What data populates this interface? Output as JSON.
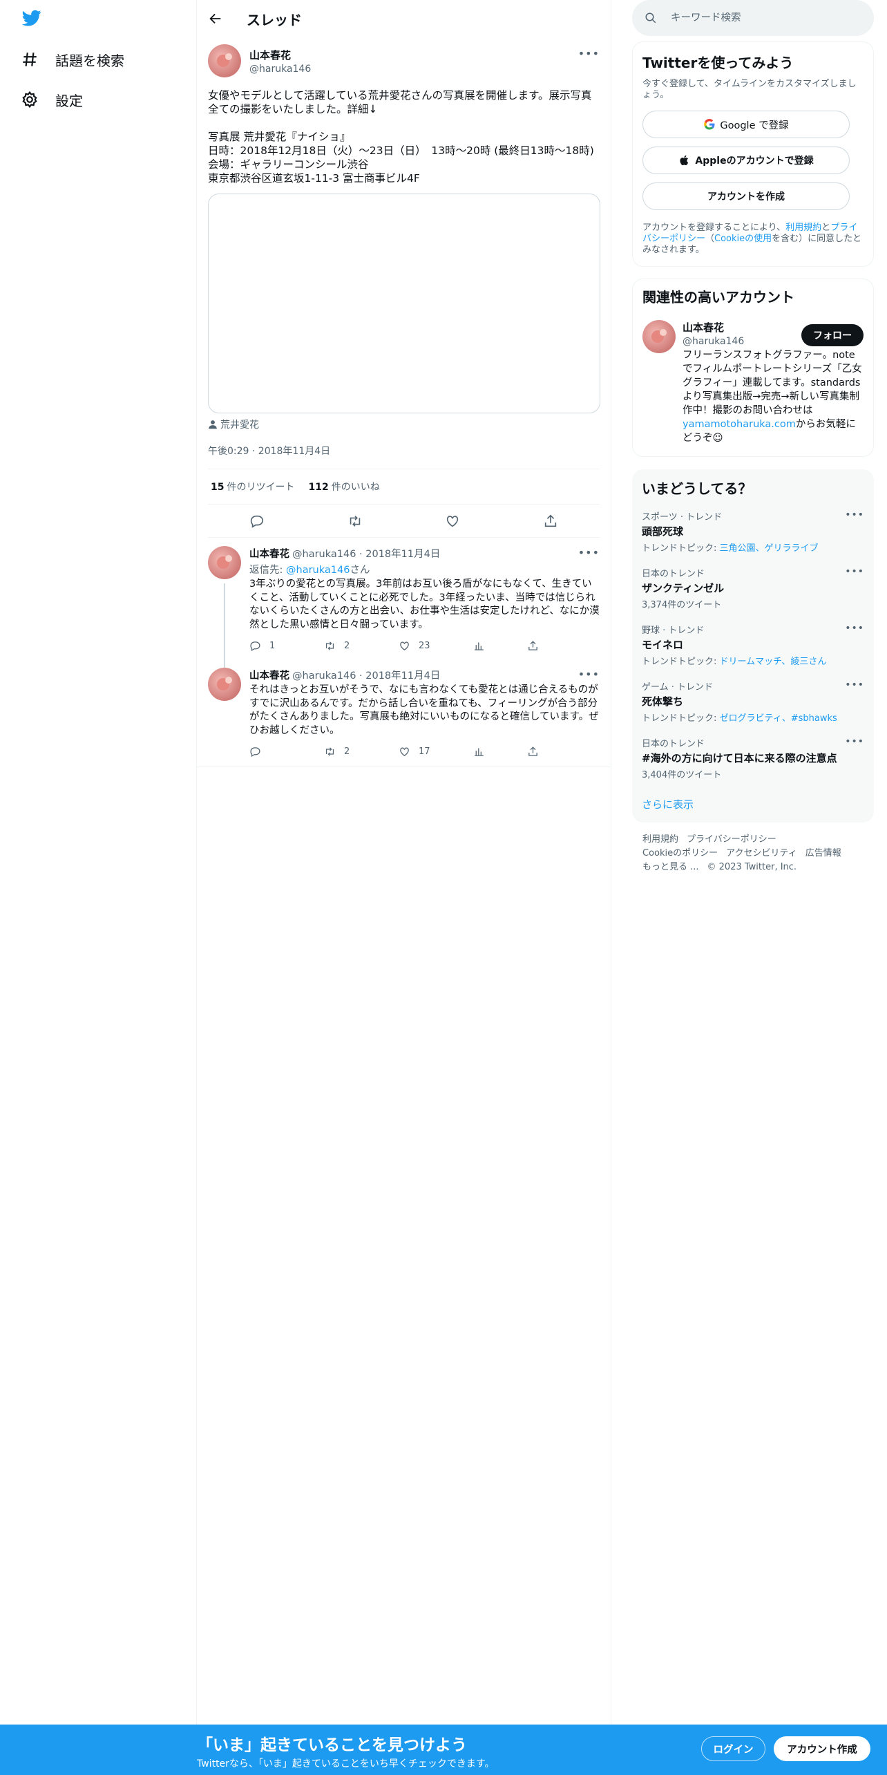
{
  "nav": {
    "explore_label": "話題を検索",
    "settings_label": "設定"
  },
  "header": {
    "title": "スレッド"
  },
  "tweet": {
    "name": "山本春花",
    "handle": "@haruka146",
    "text": "女優やモデルとして活躍している荒井愛花さんの写真展を開催します。展示写真全ての撮影をいたしました。詳細↓\n\n写真展 荒井愛花『ナイショ』\n日時：2018年12月18日（火）〜23日（日）　13時〜20時 (最終日13時〜18時)\n会場：ギャラリーコンシール渋谷\n東京都渋谷区道玄坂1-11-3 富士商事ビル4F",
    "tagged": "荒井愛花",
    "time": "午後0:29 · 2018年11月4日",
    "retweets": "15",
    "retweets_label": "件のリツイート",
    "likes": "112",
    "likes_label": "件のいいね"
  },
  "replies": [
    {
      "name": "山本春花",
      "meta": "@haruka146 · 2018年11月4日",
      "reply_prefix": "返信先: ",
      "reply_to": "@haruka146",
      "reply_suffix": "さん",
      "text": "3年ぶりの愛花との写真展。3年前はお互い後ろ盾がなにもなくて、生きていくこと、活動していくことに必死でした。3年経ったいま、当時では信じられないくらいたくさんの方と出会い、お仕事や生活は安定したけれど、なにか漠然とした黒い感情と日々闘っています。",
      "replies": "1",
      "retweets": "2",
      "likes": "23"
    },
    {
      "name": "山本春花",
      "meta": "@haruka146 · 2018年11月4日",
      "text": "それはきっとお互いがそうで、なにも言わなくても愛花とは通じ合えるものがすでに沢山あるんです。だから話し合いを重ねても、フィーリングが合う部分がたくさんありました。写真展も絶対にいいものになると確信しています。ぜひお越しください。",
      "replies": "",
      "retweets": "2",
      "likes": "17"
    }
  ],
  "search": {
    "placeholder": "キーワード検索"
  },
  "signup_card": {
    "title": "Twitterを使ってみよう",
    "subtitle": "今すぐ登録して、タイムラインをカスタマイズしましょう。",
    "google": "Google で登録",
    "apple": "Appleのアカウントで登録",
    "create": "アカウントを作成",
    "legal_1": "アカウントを登録することにより、",
    "legal_terms": "利用規約",
    "legal_and": "と",
    "legal_privacy": "プライバシーポリシー",
    "legal_open": "（",
    "legal_cookie": "Cookieの使用",
    "legal_2": "を含む）に同意したとみなされます。"
  },
  "related": {
    "title": "関連性の高いアカウント",
    "name": "山本春花",
    "handle": "@haruka146",
    "follow": "フォロー",
    "bio_1": "フリーランスフォトグラファー。noteでフィルムポートレートシリーズ「乙女グラフィー」連載してます。standardsより写真集出版→完売→新しい写真集制作中！撮影のお問い合わせは",
    "bio_link": "yamamotoharuka.com",
    "bio_2": "からお気軽にどうぞ☺︎"
  },
  "trends": {
    "title": "いまどうしてる？",
    "items": [
      {
        "category": "スポーツ · トレンド",
        "name": "頭部死球",
        "sub_label": "トレンドトピック: ",
        "sub_links": "三角公園、ゲリラライブ"
      },
      {
        "category": "日本のトレンド",
        "name": "ザンクティンゼル",
        "count": "3,374件のツイート"
      },
      {
        "category": "野球 · トレンド",
        "name": "モイネロ",
        "sub_label": "トレンドトピック: ",
        "sub_links": "ドリームマッチ、綾三さん"
      },
      {
        "category": "ゲーム · トレンド",
        "name": "死体撃ち",
        "sub_label": "トレンドトピック: ",
        "sub_links": "ゼログラビティ、#sbhawks"
      },
      {
        "category": "日本のトレンド",
        "name": "#海外の方に向けて日本に来る際の注意点",
        "count": "3,404件のツイート"
      }
    ],
    "show_more": "さらに表示"
  },
  "footer": {
    "terms": "利用規約",
    "privacy": "プライバシーポリシー",
    "cookie": "Cookieのポリシー",
    "accessibility": "アクセシビリティ",
    "ads": "広告情報",
    "more": "もっと見る ...",
    "copyright": "© 2023 Twitter, Inc."
  },
  "bottom_bar": {
    "title": "「いま」起きていることを見つけよう",
    "subtitle": "Twitterなら、「いま」起きていることをいち早くチェックできます。",
    "login": "ログイン",
    "signup": "アカウント作成"
  },
  "colors": {
    "accent": "#1d9bf0",
    "text": "#0f1419",
    "muted": "#536471"
  }
}
